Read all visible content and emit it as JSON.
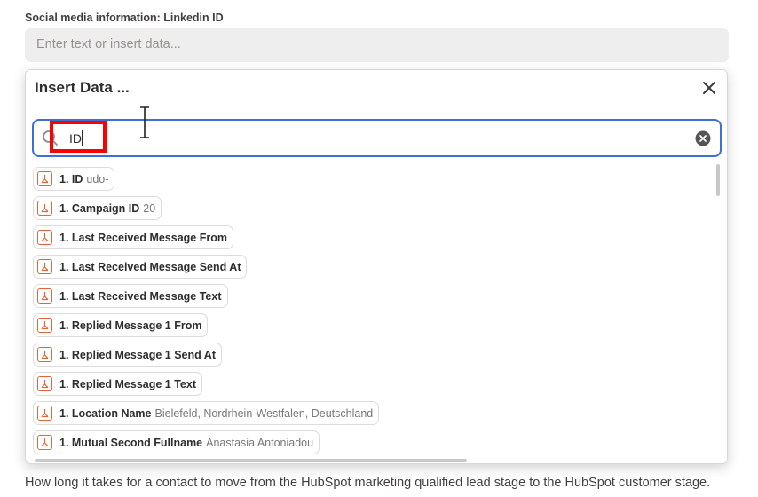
{
  "field": {
    "label": "Social media information: Linkedin ID",
    "placeholder": "Enter text or insert data..."
  },
  "popup": {
    "title": "Insert Data ...",
    "search_value": "ID"
  },
  "items": [
    {
      "key": "1. ID",
      "value": "udo-"
    },
    {
      "key": "1. Campaign ID",
      "value": "20"
    },
    {
      "key": "1. Last Received Message From",
      "value": ""
    },
    {
      "key": "1. Last Received Message Send At",
      "value": ""
    },
    {
      "key": "1. Last Received Message Text",
      "value": ""
    },
    {
      "key": "1. Replied Message 1 From",
      "value": ""
    },
    {
      "key": "1. Replied Message 1 Send At",
      "value": ""
    },
    {
      "key": "1. Replied Message 1 Text",
      "value": ""
    },
    {
      "key": "1. Location Name",
      "value": "Bielefeld, Nordrhein-Westfalen, Deutschland"
    },
    {
      "key": "1. Mutual Second Fullname",
      "value": "Anastasia Antoniadou"
    }
  ],
  "description": "How long it takes for a contact to move from the HubSpot marketing qualified lead stage to the HubSpot customer stage.",
  "colors": {
    "accent": "#3d6fd6",
    "app_icon": "#e1663c",
    "highlight": "#ff0000"
  }
}
